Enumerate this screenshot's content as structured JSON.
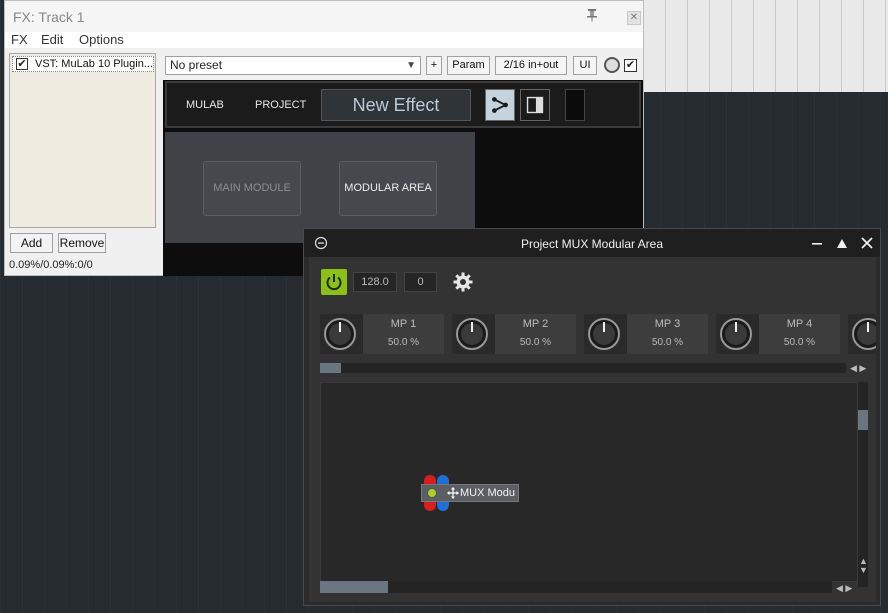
{
  "fx_window": {
    "title": "FX: Track 1",
    "menu": [
      "FX",
      "Edit",
      "Options"
    ],
    "plugin_list": [
      {
        "label": "VST: MuLab 10 Plugin...",
        "enabled": true
      }
    ],
    "add_label": "Add",
    "remove_label": "Remove",
    "status": "0.09%/0.09%:0/0",
    "preset": "No preset",
    "plus_label": "+",
    "param_label": "Param",
    "io_label": "2/16 in+out",
    "ui_label": "UI"
  },
  "mulab": {
    "tab_mulab": "MULAB",
    "tab_project": "PROJECT",
    "effect_name": "New Effect",
    "main_module_label": "MAIN MODULE",
    "modular_area_label": "MODULAR AREA"
  },
  "mux_window": {
    "title": "Project MUX Modular Area",
    "tempo": "128.0",
    "offset": "0",
    "params": [
      {
        "name": "MP 1",
        "value": "50.0 %"
      },
      {
        "name": "MP 2",
        "value": "50.0 %"
      },
      {
        "name": "MP 3",
        "value": "50.0 %"
      },
      {
        "name": "MP 4",
        "value": "50.0 %"
      }
    ],
    "node_label": "MUX Modu"
  },
  "colors": {
    "power_accent": "#8bbf1a",
    "port_red": "#d61f1f",
    "port_blue": "#1f6fd6"
  }
}
